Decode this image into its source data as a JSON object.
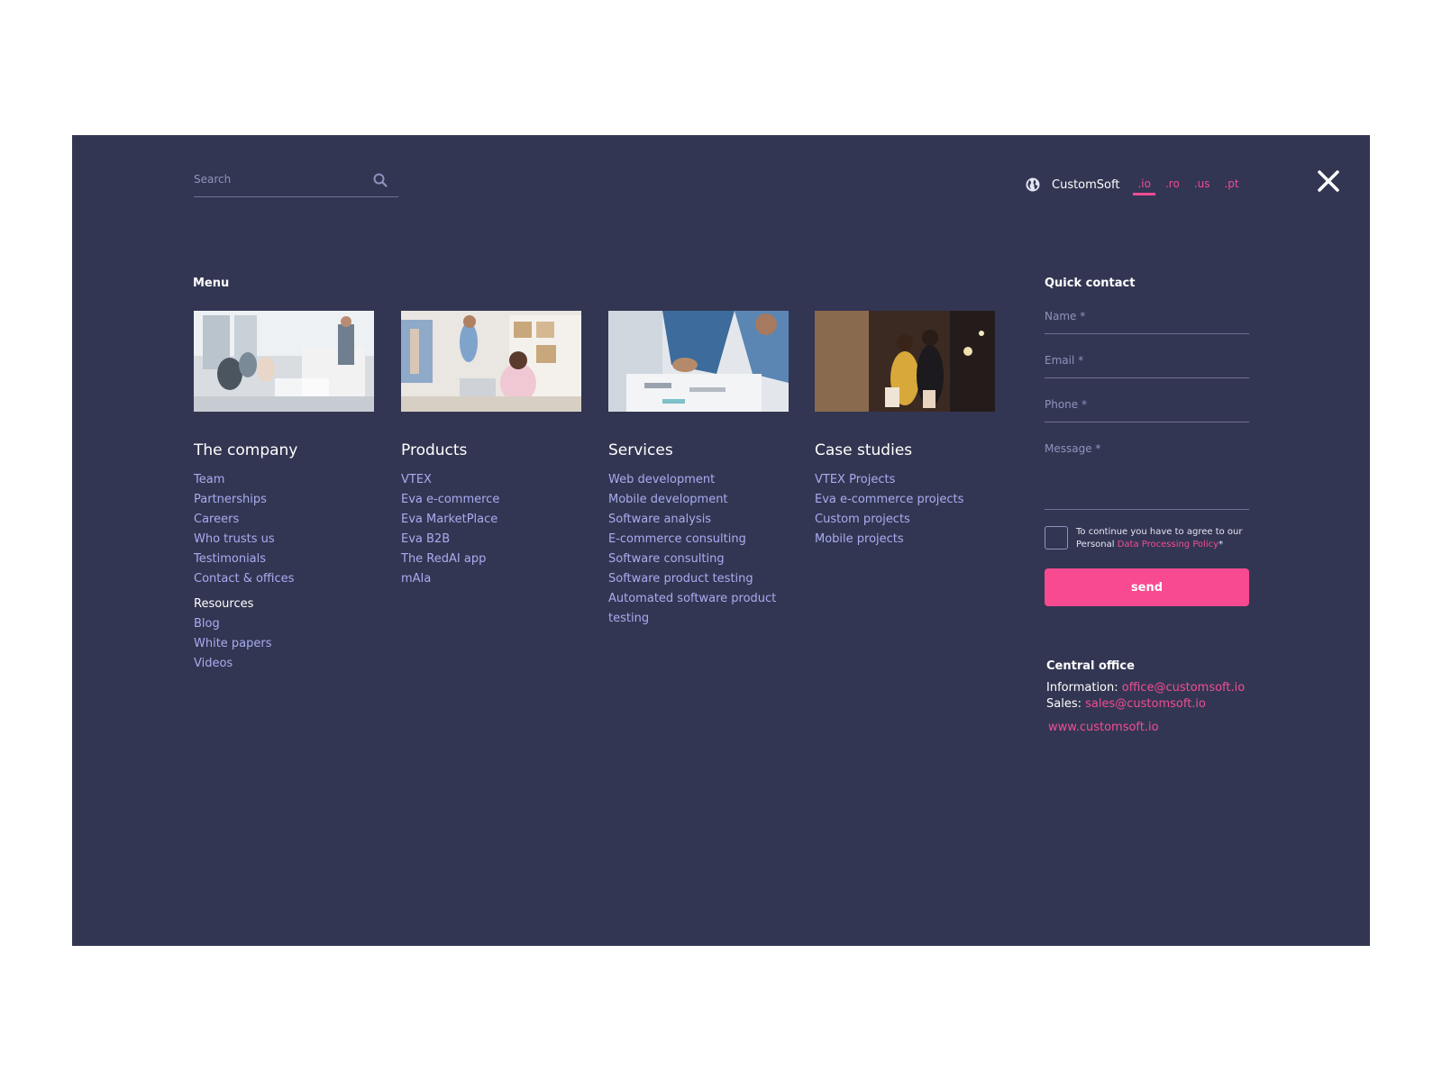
{
  "search": {
    "placeholder": "Search"
  },
  "language": {
    "brand": "CustomSoft",
    "domains": [
      ".io",
      ".ro",
      ".us",
      ".pt"
    ],
    "active": ".io"
  },
  "menu": {
    "title": "Menu",
    "columns": [
      {
        "heading": "The company",
        "items": [
          "Team",
          "Partnerships",
          "Careers",
          "Who trusts us",
          "Testimonials",
          "Contact & offices"
        ],
        "subheading": "Resources",
        "subitems": [
          "Blog",
          "White papers",
          "Videos"
        ]
      },
      {
        "heading": "Products",
        "items": [
          "VTEX",
          "Eva e-commerce",
          "Eva MarketPlace",
          "Eva B2B",
          "The RedAI app",
          "mAIa"
        ]
      },
      {
        "heading": "Services",
        "items": [
          "Web development",
          "Mobile development",
          "Software analysis",
          "E-commerce consulting",
          "Software consulting",
          "Software product testing",
          "Automated software product",
          "testing"
        ]
      },
      {
        "heading": "Case studies",
        "items": [
          "VTEX Projects",
          "Eva e-commerce projects",
          "Custom projects",
          "Mobile projects"
        ]
      }
    ]
  },
  "quick_contact": {
    "title": "Quick contact",
    "name_placeholder": "Name *",
    "email_placeholder": "Email *",
    "phone_placeholder": "Phone *",
    "message_placeholder": "Message *",
    "agree_text": "To continue you have to agree to our Personal",
    "agree_link": "Data Processing Policy",
    "agree_suffix": "*",
    "send_label": "send"
  },
  "office": {
    "title": "Central office",
    "info_label": "Information:",
    "info_email": "office@customsoft.io",
    "sales_label": "Sales:",
    "sales_email": "sales@customsoft.io",
    "website": "www.customsoft.io"
  },
  "colors": {
    "panel": "#333652",
    "accent": "#f74a91",
    "link": "#a8acf0"
  },
  "icons": [
    "search-icon",
    "globe-icon",
    "close-icon"
  ]
}
